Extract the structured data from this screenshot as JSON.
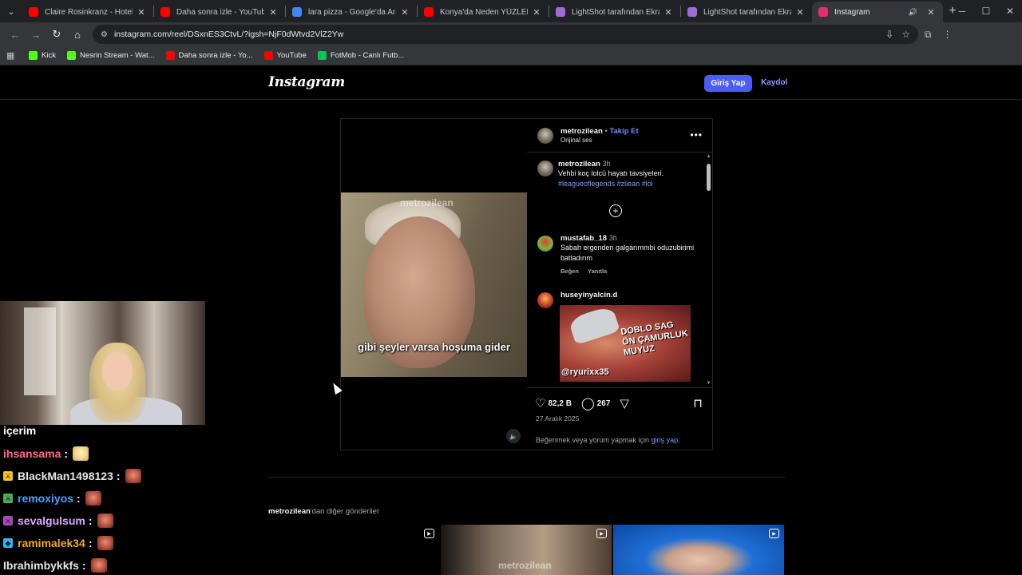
{
  "browser": {
    "tabs": [
      {
        "title": "Claire Rosinkranz - Hotel (Offic",
        "favicon": "youtube-icon",
        "color": "#ff0000"
      },
      {
        "title": "Daha sonra izle - YouTube",
        "favicon": "youtube-icon",
        "color": "#ff0000"
      },
      {
        "title": "lara pizza - Google'da Ara",
        "favicon": "google-icon",
        "color": "#4285f4"
      },
      {
        "title": "Konya'da Neden YÜZLERCE Ol",
        "favicon": "youtube-icon",
        "color": "#ff0000"
      },
      {
        "title": "LightShot tarafından Ekran Gör",
        "favicon": "lightshot-icon",
        "color": "#a06bd6"
      },
      {
        "title": "LightShot tarafından Ekran Gör",
        "favicon": "lightshot-icon",
        "color": "#a06bd6"
      },
      {
        "title": "Instagram",
        "favicon": "instagram-icon",
        "color": "#e1306c",
        "active": true
      }
    ],
    "url": "instagram.com/reel/DSxnES3CtvL/?igsh=NjF0dWtvd2VlZ2Yw",
    "bookmarks": [
      {
        "label": "Kick",
        "color": "#53fc18"
      },
      {
        "label": "Nesrin Stream - Wat...",
        "color": "#53fc18"
      },
      {
        "label": "Daha sonra izle - Yo...",
        "color": "#ff0000"
      },
      {
        "label": "YouTube",
        "color": "#ff0000"
      },
      {
        "label": "FotMob - Canlı Futb...",
        "color": "#00c853"
      }
    ]
  },
  "instagram": {
    "logo": "Instagram",
    "login_label": "Giriş Yap",
    "signup_label": "Kaydol",
    "accent_color": "#4a5df9",
    "post": {
      "watermark": "metrozilean",
      "subtitle": "gibi şeyler varsa hoşuma gider",
      "author": "metrozilean",
      "separator": "•",
      "follow_label": "Takip Et",
      "audio": "Orijinal ses",
      "caption": {
        "user": "metrozilean",
        "time": "3h",
        "text": "Vehbi koç lolcü hayatı tavsiyeleri.",
        "hashtags": "#leagueoflegends #zilean #lol"
      },
      "comments": [
        {
          "user": "mustafab_18",
          "time": "3h",
          "text": "Sabah ergenden galgarımmbi oduzubirimi batladırım",
          "like": "Beğen",
          "reply": "Yanıtla"
        },
        {
          "user": "huseyinyalcin.d",
          "meme_text": "DOBLO SAG ÖN ÇAMURLUK MUYUZ",
          "meme_tag": "@ryurixx35"
        }
      ],
      "likes": "82,2 B",
      "comment_count": "267",
      "date": "27 Aralık 2025",
      "like_prompt_prefix": "Beğenmek veya yorum yapmak için",
      "like_prompt_link": "giriş yap",
      "like_prompt_suffix": "."
    },
    "more_posts": {
      "author": "metrozilean",
      "suffix": "'dan diğer gönderiler",
      "thumb_watermark": "metrozilean"
    }
  },
  "stream": {
    "chat_title": "içerim",
    "messages": [
      {
        "user": "ihsansama",
        "color": "#ff6b8a",
        "badge": "",
        "emote": "e1"
      },
      {
        "user": "BlackMan1498123",
        "color": "#e6e6e6",
        "badge": "sword-badge-icon",
        "badge_color": "#f5c518",
        "emote": "e2"
      },
      {
        "user": "remoxiyos",
        "color": "#4aa3ff",
        "badge": "sword-badge-icon",
        "badge_color": "#4caf50",
        "emote": "e2"
      },
      {
        "user": "sevalgulsum",
        "color": "#d9a8ff",
        "badge": "sword-badge-icon",
        "badge_color": "#ab47bc",
        "emote": "e2"
      },
      {
        "user": "ramimalek34",
        "color": "#f5a623",
        "badge": "cube-badge-icon",
        "badge_color": "#29b6f6",
        "emote": "e2"
      },
      {
        "user": "Ibrahimbykkfs",
        "color": "#e6e6e6",
        "badge": "",
        "emote": "e2"
      }
    ]
  }
}
